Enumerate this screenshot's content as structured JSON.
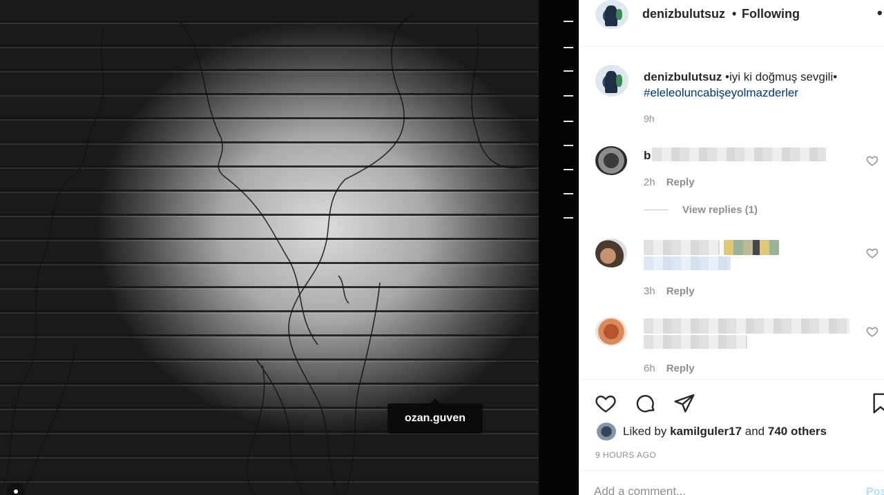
{
  "photo": {
    "tag_label": "ozan.guven"
  },
  "header": {
    "username": "denizbulutsuz",
    "separator": "•",
    "follow_status": "Following",
    "more": "•"
  },
  "caption": {
    "username": "denizbulutsuz",
    "text": " •iyi ki doğmuş sevgili•",
    "hashtag": "#eleleoluncabişeyolmazderler",
    "time": "9h"
  },
  "comments": [
    {
      "initial": "b",
      "time": "2h",
      "reply_label": "Reply",
      "view_replies": "View replies (1)"
    },
    {
      "time": "3h",
      "reply_label": "Reply"
    },
    {
      "time": "6h",
      "reply_label": "Reply"
    }
  ],
  "actions": {
    "icons": [
      "heart-icon",
      "comment-icon",
      "share-icon",
      "bookmark-icon"
    ]
  },
  "likes": {
    "prefix": "Liked by ",
    "user": "kamilguler17",
    "middle": " and ",
    "others": "740 others"
  },
  "post_time": "9 HOURS AGO",
  "add_comment": {
    "placeholder": "Add a comment...",
    "post_label": "Post"
  },
  "colors": {
    "link": "#00376b",
    "secondary_text": "#8e8e8e",
    "post_button": "#b2dffc"
  }
}
